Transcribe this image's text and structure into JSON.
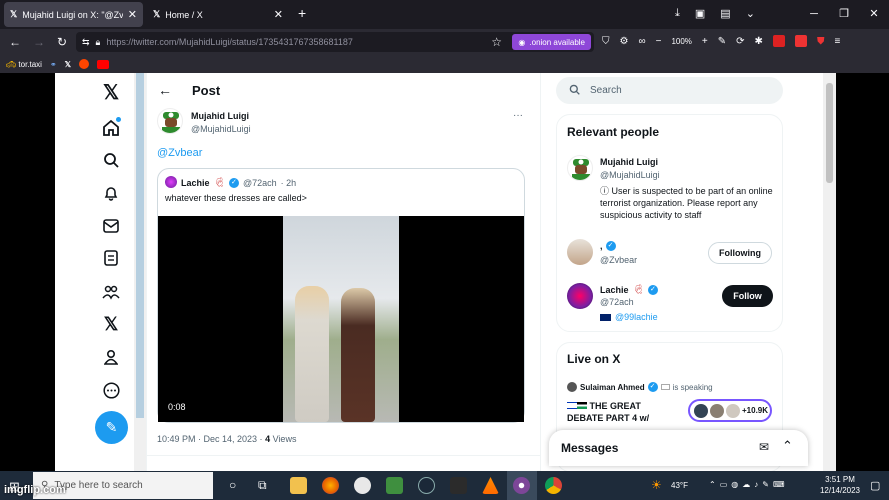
{
  "browser": {
    "tabs": [
      {
        "title": "Mujahid Luigi on X: \"@Zvbear",
        "active": true
      },
      {
        "title": "Home / X",
        "active": false
      }
    ],
    "new_tab": "+",
    "url": "https://twitter.com/MujahidLuigi/status/1735431767358681187",
    "onion_label": ".onion available",
    "zoom": "100%",
    "bookmarks": [
      "tor.taxi"
    ]
  },
  "sidebar": {
    "items": [
      "x-logo",
      "home",
      "explore",
      "notifications",
      "messages",
      "lists",
      "communities",
      "premium",
      "profile",
      "more"
    ],
    "compose_icon": "feather-plus-icon"
  },
  "post": {
    "header": "Post",
    "author_name": "Mujahid Luigi",
    "author_handle": "@MujahidLuigi",
    "more": "···",
    "text": "@Zvbear",
    "quote": {
      "name": "Lachie",
      "handle": "@72ach",
      "time": "· 2h",
      "text": "whatever these dresses are called>",
      "video_time": "0:08"
    },
    "timestamp": "10:49 PM · Dec 14, 2023 · ",
    "views_count": "4",
    "views_label": "Views"
  },
  "right": {
    "search_placeholder": "Search",
    "relevant_title": "Relevant people",
    "people": [
      {
        "name": "Mujahid Luigi",
        "handle": "@MujahidLuigi",
        "notice": "User is suspected to be part of an online terrorist organization. Please report any suspicious activity to staff"
      },
      {
        "name": ",",
        "handle": "@Zvbear",
        "button": "Following"
      },
      {
        "name": "Lachie",
        "handle": "@72ach",
        "extra": "@99lachie",
        "button": "Follow"
      }
    ],
    "live_title": "Live on X",
    "live": {
      "host": "Sulaiman Ahmed",
      "status": "is speaking",
      "title": "THE GREAT DEBATE PART 4 w/",
      "listeners": "+10.9K"
    },
    "messages_title": "Messages"
  },
  "taskbar": {
    "search_placeholder": "Type here to search",
    "temperature": "43°F",
    "time": "3:51 PM",
    "date": "12/14/2023"
  },
  "watermark": "imgflip.com"
}
